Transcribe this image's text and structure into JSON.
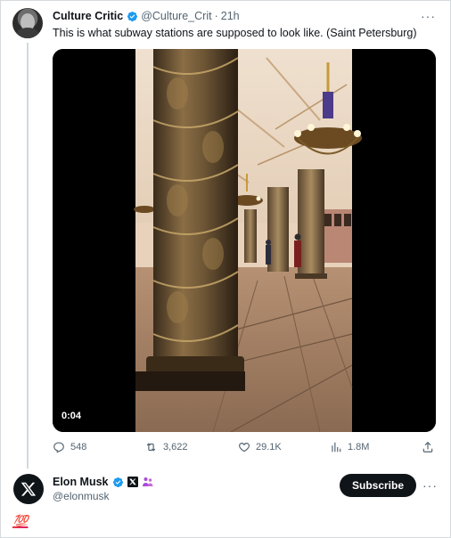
{
  "post": {
    "author_name": "Culture Critic",
    "author_handle": "@Culture_Crit",
    "separator": "·",
    "time": "21h",
    "more_label": "···",
    "text": "This is what subway stations are supposed to look like. (Saint Petersburg)",
    "media": {
      "type": "video",
      "duration": "0:04"
    },
    "metrics": {
      "replies": "548",
      "reposts": "3,622",
      "likes": "29.1K",
      "views": "1.8M"
    },
    "icons": {
      "reply": "reply-icon",
      "repost": "repost-icon",
      "like": "heart-icon",
      "views": "views-icon",
      "share": "share-icon",
      "verified": "verified-badge-icon"
    }
  },
  "reply": {
    "author_name": "Elon Musk",
    "author_handle": "@elonmusk",
    "subscribe_label": "Subscribe",
    "more_label": "···",
    "content": "💯"
  },
  "colors": {
    "verified_blue": "#1d9bf0",
    "text_primary": "#0f1419",
    "text_secondary": "#536471",
    "button_bg": "#0f1419"
  }
}
